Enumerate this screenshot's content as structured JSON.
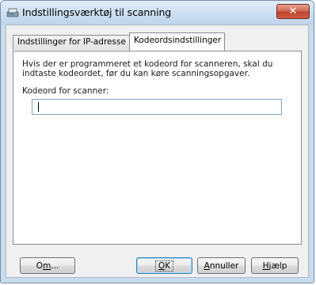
{
  "window": {
    "title": "Indstillingsværktøj til scanning",
    "close_symbol": "✕"
  },
  "tabs": [
    {
      "label": "Indstillinger for IP-adresse",
      "active": false
    },
    {
      "label": "Kodeordsindstillinger",
      "active": true
    }
  ],
  "panel": {
    "info_text": "Hvis der er programmeret et kodeord for scanneren, skal du indtaste kodeordet, før du kan køre scanningsopgaver.",
    "field_label": "Kodeord for scanner:",
    "password_value": ""
  },
  "buttons": {
    "about": {
      "pre": "O",
      "ul": "m",
      "post": "..."
    },
    "ok": {
      "pre": "",
      "ul": "O",
      "post": "K"
    },
    "cancel": {
      "pre": "",
      "ul": "A",
      "post": "nnuller"
    },
    "help": {
      "pre": "",
      "ul": "H",
      "post": "jælp"
    }
  },
  "colors": {
    "frame": "#c9dcef",
    "close_button": "#c0452f",
    "input_border": "#7ea3c7",
    "default_button_border": "#3c7fb1"
  },
  "icons": {
    "app": "scanner-settings-icon",
    "close": "close-icon"
  }
}
